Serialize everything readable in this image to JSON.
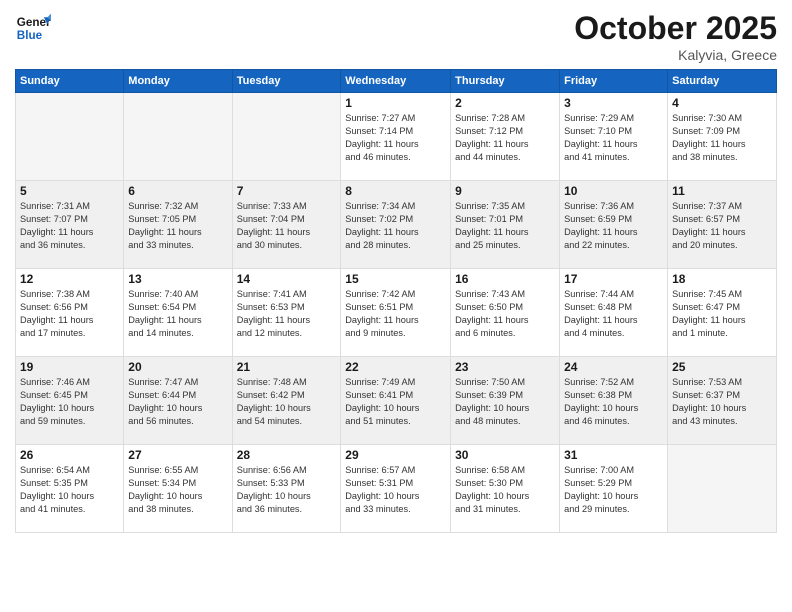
{
  "logo": {
    "line1": "General",
    "line2": "Blue"
  },
  "header": {
    "month": "October 2025",
    "location": "Kalyvia, Greece"
  },
  "days_of_week": [
    "Sunday",
    "Monday",
    "Tuesday",
    "Wednesday",
    "Thursday",
    "Friday",
    "Saturday"
  ],
  "weeks": [
    [
      {
        "num": "",
        "info": ""
      },
      {
        "num": "",
        "info": ""
      },
      {
        "num": "",
        "info": ""
      },
      {
        "num": "1",
        "info": "Sunrise: 7:27 AM\nSunset: 7:14 PM\nDaylight: 11 hours\nand 46 minutes."
      },
      {
        "num": "2",
        "info": "Sunrise: 7:28 AM\nSunset: 7:12 PM\nDaylight: 11 hours\nand 44 minutes."
      },
      {
        "num": "3",
        "info": "Sunrise: 7:29 AM\nSunset: 7:10 PM\nDaylight: 11 hours\nand 41 minutes."
      },
      {
        "num": "4",
        "info": "Sunrise: 7:30 AM\nSunset: 7:09 PM\nDaylight: 11 hours\nand 38 minutes."
      }
    ],
    [
      {
        "num": "5",
        "info": "Sunrise: 7:31 AM\nSunset: 7:07 PM\nDaylight: 11 hours\nand 36 minutes."
      },
      {
        "num": "6",
        "info": "Sunrise: 7:32 AM\nSunset: 7:05 PM\nDaylight: 11 hours\nand 33 minutes."
      },
      {
        "num": "7",
        "info": "Sunrise: 7:33 AM\nSunset: 7:04 PM\nDaylight: 11 hours\nand 30 minutes."
      },
      {
        "num": "8",
        "info": "Sunrise: 7:34 AM\nSunset: 7:02 PM\nDaylight: 11 hours\nand 28 minutes."
      },
      {
        "num": "9",
        "info": "Sunrise: 7:35 AM\nSunset: 7:01 PM\nDaylight: 11 hours\nand 25 minutes."
      },
      {
        "num": "10",
        "info": "Sunrise: 7:36 AM\nSunset: 6:59 PM\nDaylight: 11 hours\nand 22 minutes."
      },
      {
        "num": "11",
        "info": "Sunrise: 7:37 AM\nSunset: 6:57 PM\nDaylight: 11 hours\nand 20 minutes."
      }
    ],
    [
      {
        "num": "12",
        "info": "Sunrise: 7:38 AM\nSunset: 6:56 PM\nDaylight: 11 hours\nand 17 minutes."
      },
      {
        "num": "13",
        "info": "Sunrise: 7:40 AM\nSunset: 6:54 PM\nDaylight: 11 hours\nand 14 minutes."
      },
      {
        "num": "14",
        "info": "Sunrise: 7:41 AM\nSunset: 6:53 PM\nDaylight: 11 hours\nand 12 minutes."
      },
      {
        "num": "15",
        "info": "Sunrise: 7:42 AM\nSunset: 6:51 PM\nDaylight: 11 hours\nand 9 minutes."
      },
      {
        "num": "16",
        "info": "Sunrise: 7:43 AM\nSunset: 6:50 PM\nDaylight: 11 hours\nand 6 minutes."
      },
      {
        "num": "17",
        "info": "Sunrise: 7:44 AM\nSunset: 6:48 PM\nDaylight: 11 hours\nand 4 minutes."
      },
      {
        "num": "18",
        "info": "Sunrise: 7:45 AM\nSunset: 6:47 PM\nDaylight: 11 hours\nand 1 minute."
      }
    ],
    [
      {
        "num": "19",
        "info": "Sunrise: 7:46 AM\nSunset: 6:45 PM\nDaylight: 10 hours\nand 59 minutes."
      },
      {
        "num": "20",
        "info": "Sunrise: 7:47 AM\nSunset: 6:44 PM\nDaylight: 10 hours\nand 56 minutes."
      },
      {
        "num": "21",
        "info": "Sunrise: 7:48 AM\nSunset: 6:42 PM\nDaylight: 10 hours\nand 54 minutes."
      },
      {
        "num": "22",
        "info": "Sunrise: 7:49 AM\nSunset: 6:41 PM\nDaylight: 10 hours\nand 51 minutes."
      },
      {
        "num": "23",
        "info": "Sunrise: 7:50 AM\nSunset: 6:39 PM\nDaylight: 10 hours\nand 48 minutes."
      },
      {
        "num": "24",
        "info": "Sunrise: 7:52 AM\nSunset: 6:38 PM\nDaylight: 10 hours\nand 46 minutes."
      },
      {
        "num": "25",
        "info": "Sunrise: 7:53 AM\nSunset: 6:37 PM\nDaylight: 10 hours\nand 43 minutes."
      }
    ],
    [
      {
        "num": "26",
        "info": "Sunrise: 6:54 AM\nSunset: 5:35 PM\nDaylight: 10 hours\nand 41 minutes."
      },
      {
        "num": "27",
        "info": "Sunrise: 6:55 AM\nSunset: 5:34 PM\nDaylight: 10 hours\nand 38 minutes."
      },
      {
        "num": "28",
        "info": "Sunrise: 6:56 AM\nSunset: 5:33 PM\nDaylight: 10 hours\nand 36 minutes."
      },
      {
        "num": "29",
        "info": "Sunrise: 6:57 AM\nSunset: 5:31 PM\nDaylight: 10 hours\nand 33 minutes."
      },
      {
        "num": "30",
        "info": "Sunrise: 6:58 AM\nSunset: 5:30 PM\nDaylight: 10 hours\nand 31 minutes."
      },
      {
        "num": "31",
        "info": "Sunrise: 7:00 AM\nSunset: 5:29 PM\nDaylight: 10 hours\nand 29 minutes."
      },
      {
        "num": "",
        "info": ""
      }
    ]
  ]
}
